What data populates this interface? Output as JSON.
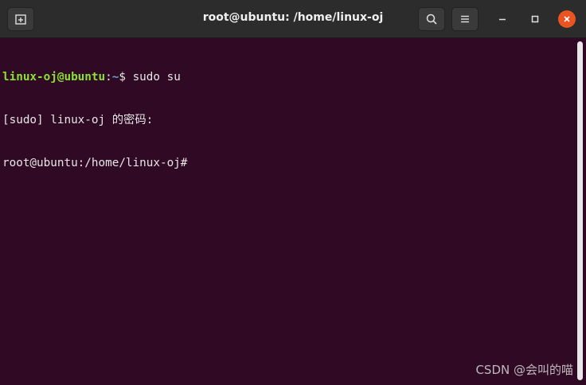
{
  "window": {
    "title": "root@ubuntu: /home/linux-oj",
    "icons": {
      "new_tab": "new-tab-icon",
      "search": "search-icon",
      "menu": "hamburger-menu-icon",
      "minimize": "minimize-icon",
      "maximize": "maximize-icon",
      "close": "close-icon"
    },
    "colors": {
      "titlebar": "#2c2c2c",
      "terminal_bg": "#300a24",
      "close_button": "#e95420",
      "prompt_user": "#8ae234",
      "prompt_path": "#729fcf"
    }
  },
  "terminal": {
    "lines": [
      {
        "prompt_user": "linux-oj@ubuntu",
        "prompt_sep": ":",
        "prompt_path": "~",
        "prompt_symbol": "$ ",
        "command": "sudo su"
      },
      {
        "text": "[sudo] linux-oj 的密码:"
      },
      {
        "text": "root@ubuntu:/home/linux-oj#"
      }
    ]
  },
  "watermark": "CSDN @会叫的喵"
}
